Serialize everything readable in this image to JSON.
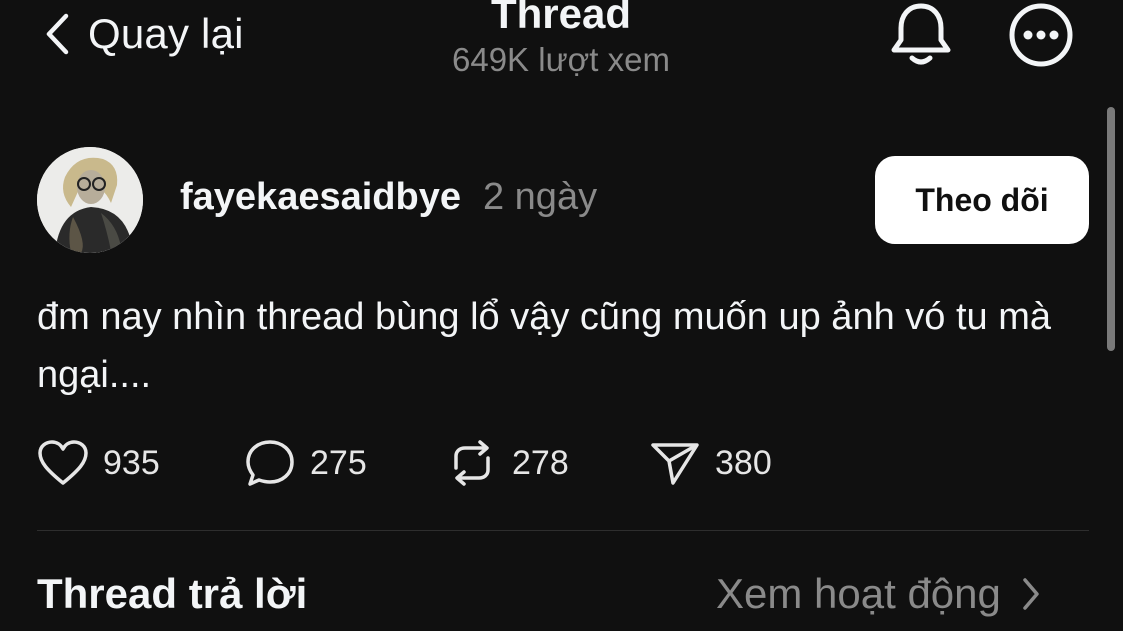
{
  "header": {
    "back_label": "Quay lại",
    "title": "Thread",
    "views": "649K lượt xem"
  },
  "post": {
    "username": "fayekaesaidbye",
    "time": "2 ngày",
    "follow_label": "Theo dõi",
    "text": "đm nay nhìn thread bùng lổ vậy cũng muốn up ảnh vó tu mà ngại....",
    "actions": {
      "likes": "935",
      "comments": "275",
      "reposts": "278",
      "shares": "380"
    }
  },
  "replies": {
    "title": "Thread trả lời",
    "activity_label": "Xem hoạt động"
  },
  "icons": [
    "chevron-left-icon",
    "bell-icon",
    "more-icon",
    "heart-icon",
    "comment-icon",
    "repost-icon",
    "send-icon",
    "chevron-right-icon"
  ],
  "colors": {
    "background": "#101010",
    "text": "#f3f5f7",
    "muted": "#8a8a8a",
    "button_bg": "#ffffff"
  }
}
